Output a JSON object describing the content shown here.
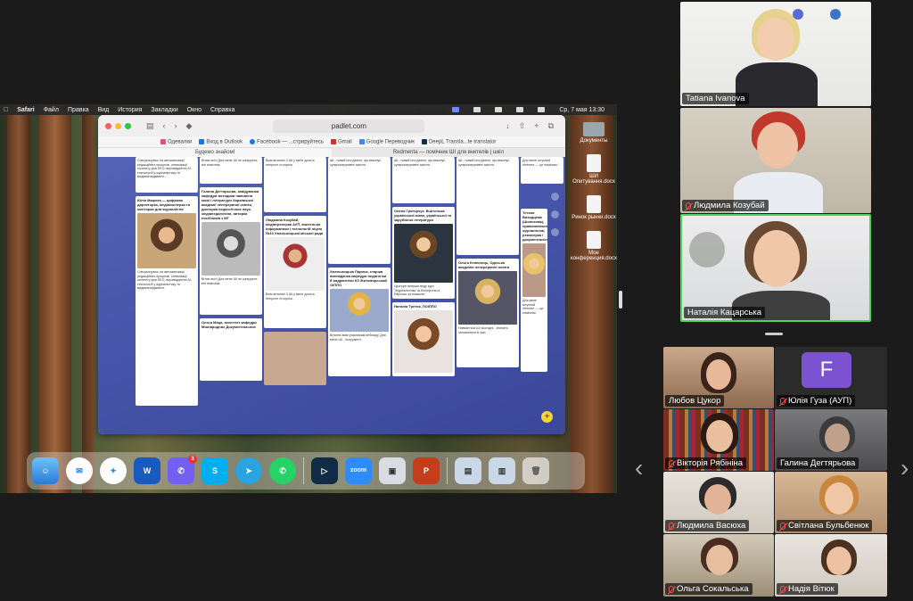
{
  "mac_menubar": {
    "apple": "",
    "app": "Safari",
    "items": [
      "Файл",
      "Правка",
      "Вид",
      "История",
      "Закладки",
      "Окно",
      "Справка"
    ],
    "clock": "Ср, 7 мая  13:30"
  },
  "browser": {
    "url": "padlet.com",
    "bookmarks": [
      "Одевалки",
      "Вход в Outlook",
      "Facebook — ...стрируйтесь",
      "Gmail",
      "Google Переводчик",
      "DeepL Transla...te translator"
    ],
    "tabs": [
      "Будемо знайомі",
      "Redmenta — помічник ШІ для вчителів | шкіл"
    ],
    "padlet_cards": [
      {
        "title": "Юлія Мацюта — цифрова директорка, медіаексперка та менторка для журналістів",
        "body": "Спеціалізуюсь на автоматизації редакційних процесів, оптимізації контенту для SEO, впровадженні AI-технологій у журналістику та медіаменеджмент."
      },
      {
        "title": "Галина Дегтярьова, завідувачка кафедри методики навчання мові і літератури Харківської академії неперервної освіти, докторка педагогічних наук, медіапедагогиня, авторка посібників з МГ",
        "body": "Вітаю всіх! Для мене ШІ не конкурент, він помічник."
      },
      {
        "title": "Людмила Козубай, медіатренерка АУП, вчителька інформатики і технологій ліцею №10 Хмельницької міської ради",
        "body": "Всім вітання! З ШІ у мене досить непрості стосунки."
      },
      {
        "title": "Хмельницька Лариса, старша викладачка кафедри педагогіки й андрагогіки КЗ Житомирський ОІППО",
        "body": "Вітання всім учасникам вебінару. Для мене ШІ - інструмент."
      },
      {
        "title": "Олена Григорчук. Вчителька української мови, української та зарубіжної літератури",
        "body": "ШІ - новий інструмент, що виконує супероперативні запити."
      },
      {
        "title": "Наталія Третяк, ЛОІППО",
        "body": "Цьогоріч вперше веду курс \"Журналістика та блогерство в Еврогаш за книжкою\""
      },
      {
        "title": "Ольга Кепюнець, Одеська академія неперервної освіти",
        "body": "Навчається ШІ сьогодні - значить залишитися в часі."
      },
      {
        "title": "Тетяна Виходцева (Шолохова), правознавчиня, журналістка, режисерка і документалістка",
        "body": "Для мене штучний інтелект — це помічник."
      },
      {
        "title": "Ольга Маца, асистент кафедри Міжнародних Документальних",
        "body": ""
      }
    ]
  },
  "desktop": {
    "files": [
      "Документы",
      "ШИ Опитування.docx",
      "Ринок рынки.docx",
      "Мое конференция.docx"
    ]
  },
  "dock": {
    "apps": [
      "finder-icon",
      "messenger-icon",
      "safari-icon",
      "word-icon",
      "viber-icon",
      "skype-icon",
      "telegram-icon",
      "whatsapp-icon",
      "deepl-icon",
      "zoom-icon",
      "preview-icon",
      "powerpoint-icon",
      "downloads-icon",
      "screens-icon",
      "trash-icon"
    ],
    "viber_badge": "3"
  },
  "participants_top": [
    {
      "name": "Tatiana Ivanova",
      "muted": false
    },
    {
      "name": "Людмила Козубай",
      "muted": true
    },
    {
      "name": "Наталія Кацарська",
      "muted": false
    }
  ],
  "participants_grid": [
    {
      "name": "Любов Цукор",
      "muted": false
    },
    {
      "name": "Юлія Гуза (АУП)",
      "muted": true,
      "avatar_letter": "F"
    },
    {
      "name": "Вікторія Рябініна",
      "muted": true
    },
    {
      "name": "Галина Дегтярьова",
      "muted": false
    },
    {
      "name": "Людмила Васюха",
      "muted": true
    },
    {
      "name": "Світлана Бульбенюк",
      "muted": true
    },
    {
      "name": "Ольга Сокальська",
      "muted": true
    },
    {
      "name": "Надія Вітюк",
      "muted": true
    }
  ],
  "colors": {
    "active_speaker_border": "#4fd35a",
    "padlet_bg": "#4553a8",
    "mic_off": "#ff4d4d"
  }
}
